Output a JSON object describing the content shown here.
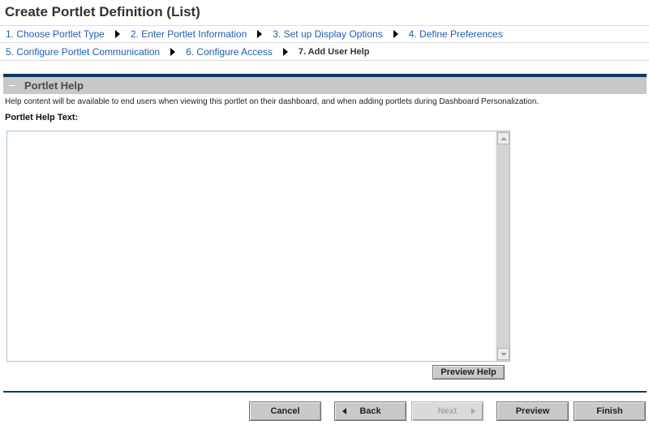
{
  "page": {
    "title": "Create Portlet Definition (List)"
  },
  "wizard": {
    "steps": [
      {
        "label": "1. Choose Portlet Type",
        "current": false
      },
      {
        "label": "2. Enter Portlet Information",
        "current": false
      },
      {
        "label": "3. Set up Display Options",
        "current": false
      },
      {
        "label": "4. Define Preferences",
        "current": false
      },
      {
        "label": "5. Configure Portlet Communication",
        "current": false
      },
      {
        "label": "6. Configure Access",
        "current": false
      },
      {
        "label": "7. Add User Help",
        "current": true
      }
    ]
  },
  "section": {
    "title": "Portlet Help",
    "description": "Help content will be available to end users when viewing this portlet on their dashboard, and when adding portlets during Dashboard Personalization.",
    "field_label": "Portlet Help Text:",
    "field_value": "",
    "preview_help_label": "Preview Help"
  },
  "footer": {
    "cancel_label": "Cancel",
    "back_label": "Back",
    "next_label": "Next",
    "preview_label": "Preview",
    "finish_label": "Finish"
  },
  "colors": {
    "link": "#1f5fb0",
    "section_bar": "#0d3a62",
    "section_header_bg": "#c8c8c8",
    "button_bg": "#c9c9c9"
  }
}
